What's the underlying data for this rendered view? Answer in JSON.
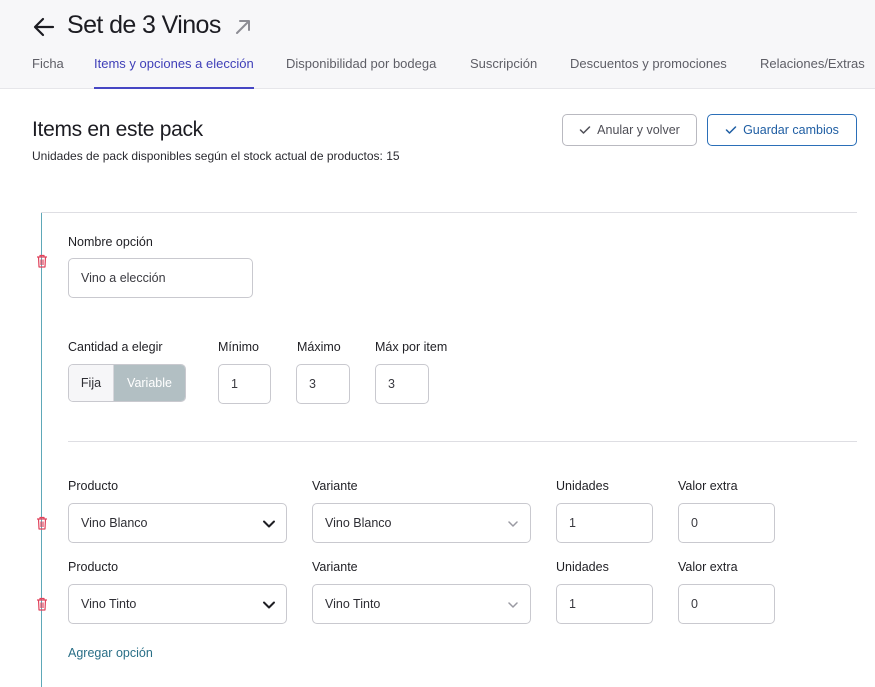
{
  "header": {
    "title": "Set de 3 Vinos",
    "back_icon": "arrow-left-icon",
    "external_icon": "arrow-up-right-icon",
    "tabs": [
      {
        "label": "Ficha",
        "active": false
      },
      {
        "label": "Items y opciones a elección",
        "active": true
      },
      {
        "label": "Disponibilidad por bodega",
        "active": false
      },
      {
        "label": "Suscripción",
        "active": false
      },
      {
        "label": "Descuentos y promociones",
        "active": false
      },
      {
        "label": "Relaciones/Extras",
        "active": false
      }
    ]
  },
  "section": {
    "title": "Items en este pack",
    "subtitle": "Unidades de pack disponibles según el stock actual de productos: 15",
    "cancel_label": "Anular y volver",
    "save_label": "Guardar cambios"
  },
  "option": {
    "name_label": "Nombre opción",
    "name_value": "Vino a elección",
    "quantity_label": "Cantidad a elegir",
    "mode_fija": "Fija",
    "mode_variable": "Variable",
    "selected_mode": "Variable",
    "min_label": "Mínimo",
    "min_value": "1",
    "max_label": "Máximo",
    "max_value": "3",
    "max_per_item_label": "Máx por item",
    "max_per_item_value": "3"
  },
  "items": [
    {
      "product_label": "Producto",
      "product_value": "Vino Blanco",
      "variant_label": "Variante",
      "variant_value": "Vino Blanco",
      "units_label": "Unidades",
      "units_value": "1",
      "extra_label": "Valor extra",
      "extra_value": "0"
    },
    {
      "product_label": "Producto",
      "product_value": "Vino Tinto",
      "variant_label": "Variante",
      "variant_value": "Vino Tinto",
      "units_label": "Unidades",
      "units_value": "1",
      "extra_label": "Valor extra",
      "extra_value": "0"
    }
  ],
  "add_option_label": "Agregar opción",
  "colors": {
    "accent": "#4646c4",
    "save_border": "#2b6fb8",
    "delete": "#e0435c",
    "timeline": "#5ea8b8",
    "variable_bg": "#b2bfc3",
    "link": "#2a6f87"
  }
}
